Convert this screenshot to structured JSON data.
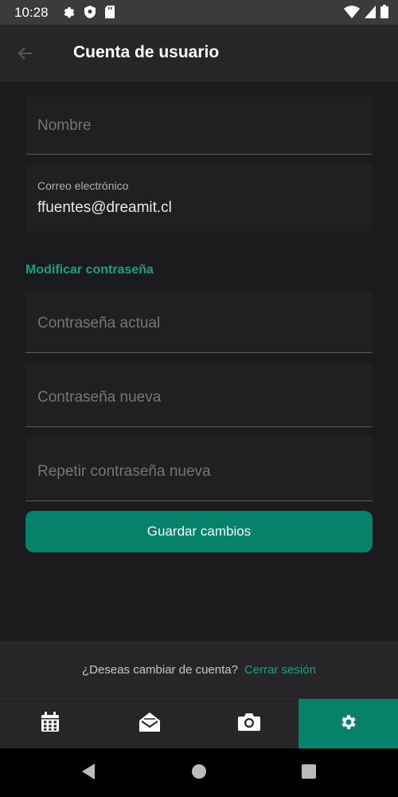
{
  "status_bar": {
    "time": "10:28",
    "left_icons": [
      "gear-icon",
      "shield-icon",
      "sd-card-icon"
    ],
    "right_icons": [
      "wifi-icon",
      "signal-icon",
      "battery-icon"
    ]
  },
  "appbar": {
    "title": "Cuenta de usuario",
    "back_icon": "arrow-left-icon"
  },
  "form": {
    "name_placeholder": "Nombre",
    "email_label": "Correo electrónico",
    "email_value": "ffuentes@dreamit.cl",
    "password_section_title": "Modificar contraseña",
    "current_password_placeholder": "Contraseña actual",
    "new_password_placeholder": "Contraseña nueva",
    "repeat_password_placeholder": "Repetir contraseña nueva",
    "save_label": "Guardar cambios"
  },
  "footer": {
    "question": "¿Deseas cambiar de cuenta?",
    "logout_link": "Cerrar sesión"
  },
  "bottom_nav": {
    "items": [
      {
        "icon": "calendar-icon",
        "active": false
      },
      {
        "icon": "mail-open-icon",
        "active": false
      },
      {
        "icon": "camera-icon",
        "active": false
      },
      {
        "icon": "settings-icon",
        "active": true
      }
    ]
  },
  "colors": {
    "accent": "#058269",
    "accent_text": "#16a082",
    "background": "#1b1b1d"
  }
}
